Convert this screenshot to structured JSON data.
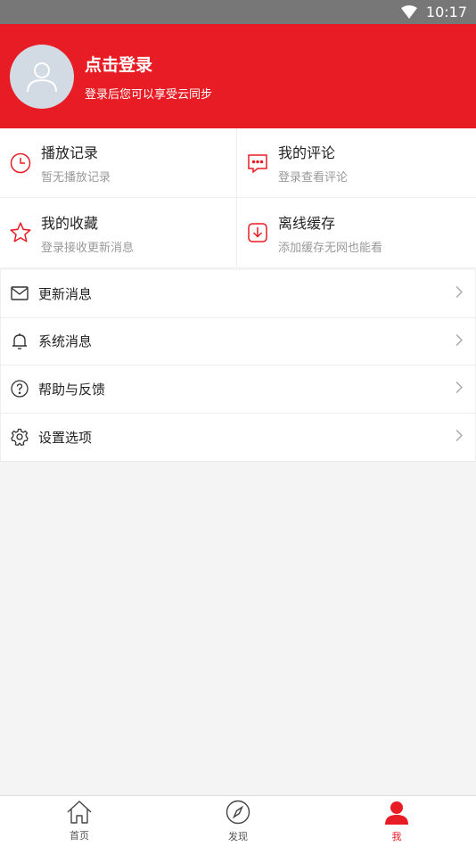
{
  "status": {
    "time": "10:17"
  },
  "header": {
    "title": "点击登录",
    "subtitle": "登录后您可以享受云同步"
  },
  "grid": [
    {
      "title": "播放记录",
      "sub": "暂无播放记录",
      "icon": "clock-icon"
    },
    {
      "title": "我的评论",
      "sub": "登录查看评论",
      "icon": "comment-icon"
    },
    {
      "title": "我的收藏",
      "sub": "登录接收更新消息",
      "icon": "star-icon"
    },
    {
      "title": "离线缓存",
      "sub": "添加缓存无网也能看",
      "icon": "download-icon"
    }
  ],
  "list": [
    {
      "label": "更新消息",
      "icon": "mail-icon"
    },
    {
      "label": "系统消息",
      "icon": "bell-icon"
    },
    {
      "label": "帮助与反馈",
      "icon": "help-icon"
    },
    {
      "label": "设置选项",
      "icon": "gear-icon"
    }
  ],
  "tabs": [
    {
      "label": "首页",
      "icon": "home-icon"
    },
    {
      "label": "发现",
      "icon": "compass-icon"
    },
    {
      "label": "我",
      "icon": "user-icon",
      "active": true
    }
  ],
  "colors": {
    "accent": "#e81c24",
    "statusbar": "#777777"
  }
}
